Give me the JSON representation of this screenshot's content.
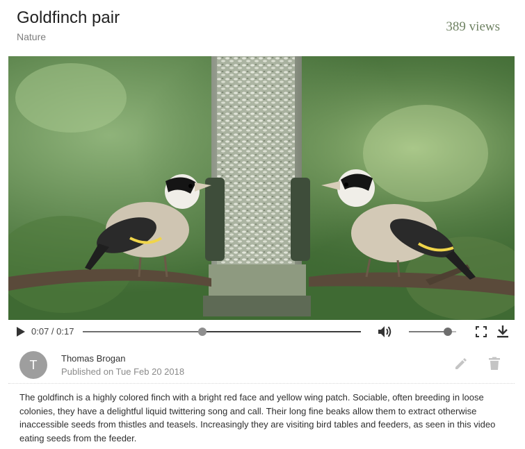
{
  "video": {
    "title": "Goldfinch pair",
    "category": "Nature",
    "views": "389 views"
  },
  "player": {
    "time_display": "0:07 / 0:17",
    "progress_fraction": 0.43,
    "volume_fraction": 0.82,
    "icons": {
      "play": "play-icon",
      "volume": "volume-icon",
      "fullscreen": "fullscreen-icon",
      "download": "download-icon"
    }
  },
  "author": {
    "avatar_letter": "T",
    "name": "Thomas Brogan",
    "published": "Published on Tue Feb 20 2018"
  },
  "actions": {
    "icons": {
      "edit": "pencil-icon",
      "delete": "trash-icon"
    }
  },
  "description": "The goldfinch is a highly colored finch with a bright red face and yellow wing patch. Sociable, often breeding in loose colonies, they have a delightful liquid twittering song and call. Their long fine beaks allow them to extract otherwise inaccessible seeds from thistles and teasels. Increasingly they are visiting bird tables and feeders, as seen in this video eating seeds from the feeder.",
  "colors": {
    "views_text": "#6f8263",
    "avatar_bg": "#9e9e9e",
    "icon_gray": "#bdbdbd"
  }
}
